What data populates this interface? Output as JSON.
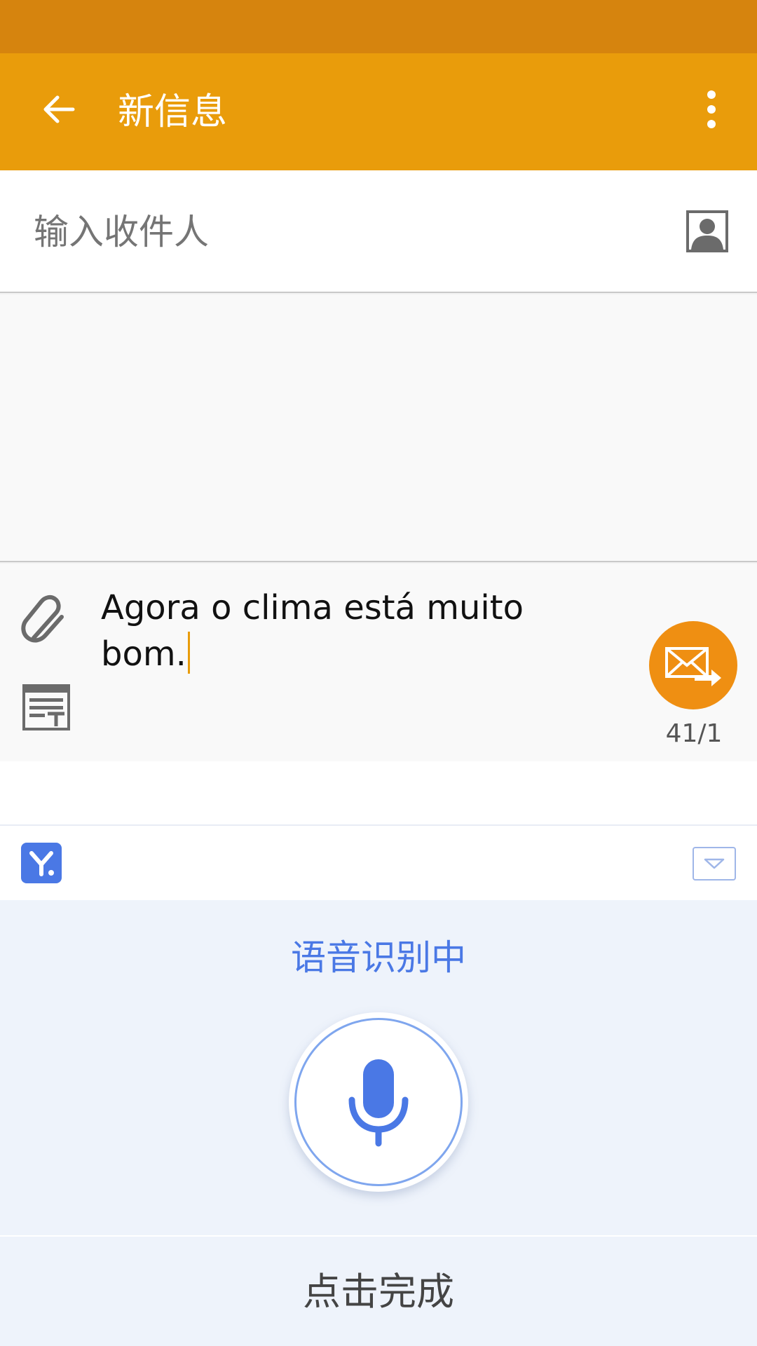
{
  "app_bar": {
    "title": "新信息",
    "back_icon": "arrow-left-icon",
    "more_icon": "more-vert-icon",
    "color": "#e99c0b",
    "status_bar_color": "#d6840e"
  },
  "recipient": {
    "placeholder": "输入收件人",
    "contact_icon": "contact-person-icon"
  },
  "compose": {
    "text": "Agora o clima está muito bom.",
    "attach_icon": "paperclip-icon",
    "template_icon": "text-template-icon",
    "send_icon": "send-mail-icon",
    "send_color": "#ef8f12",
    "counter": "41/1"
  },
  "ime": {
    "logo_icon": "ime-logo-icon",
    "collapse_icon": "collapse-keyboard-icon",
    "voice_status": "语音识别中",
    "mic_icon": "microphone-icon",
    "done_label": "点击完成",
    "accent_color": "#4a78e5"
  }
}
